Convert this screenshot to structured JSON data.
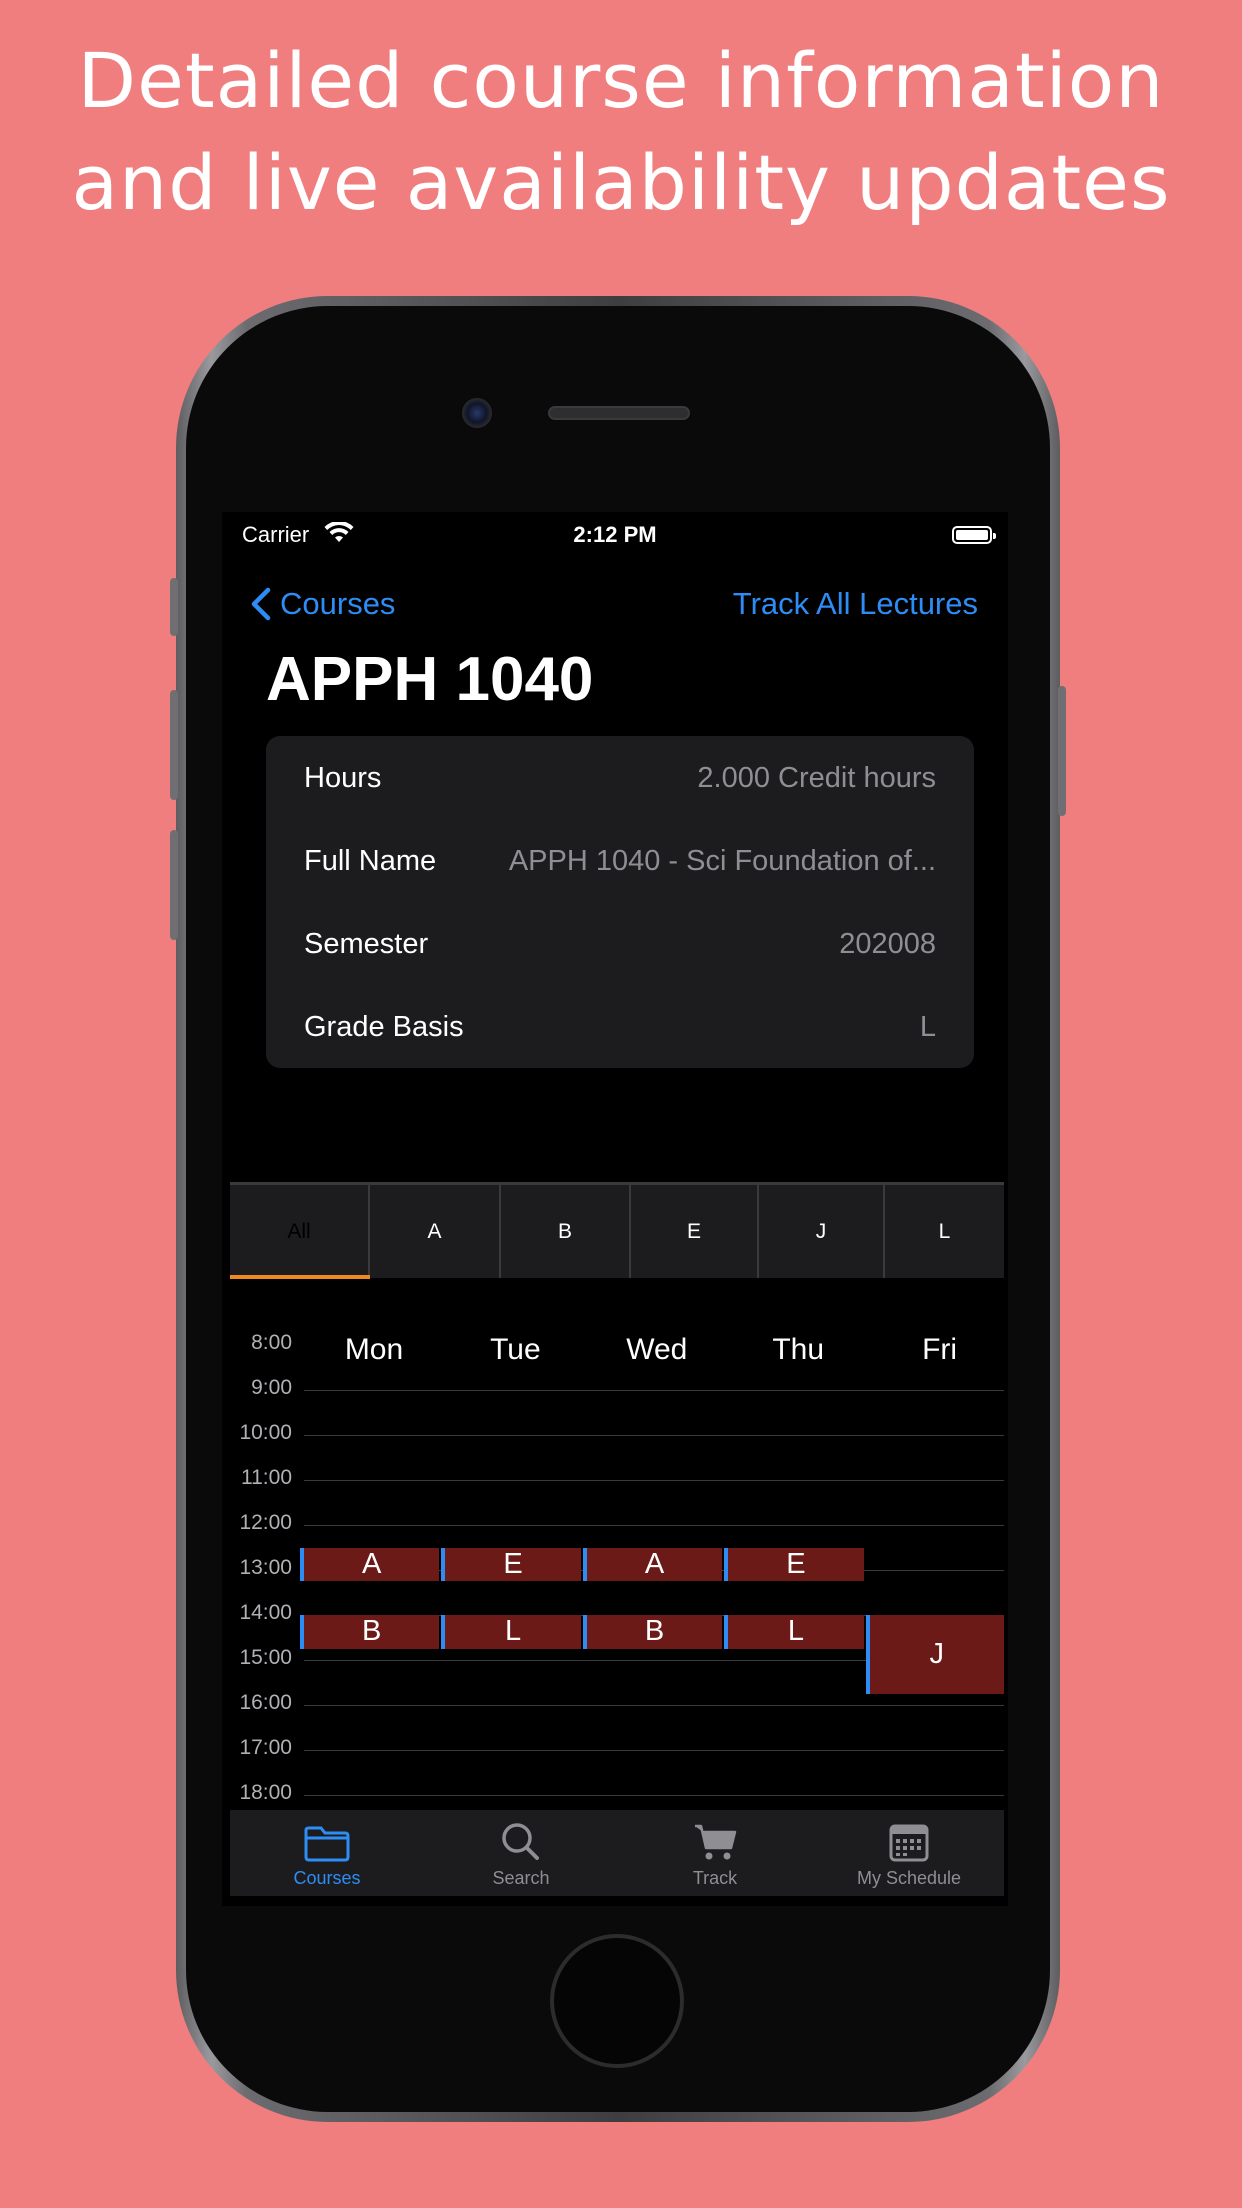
{
  "headline": {
    "line1": "Detailed course information",
    "line2": "and live availability updates"
  },
  "status_bar": {
    "carrier": "Carrier",
    "time": "2:12 PM"
  },
  "nav": {
    "back_label": "Courses",
    "action_label": "Track All Lectures"
  },
  "course": {
    "title": "APPH 1040",
    "info": [
      {
        "key": "Hours",
        "value": "2.000 Credit hours"
      },
      {
        "key": "Full Name",
        "value": "APPH 1040 - Sci Foundation of..."
      },
      {
        "key": "Semester",
        "value": "202008"
      },
      {
        "key": "Grade Basis",
        "value": "L"
      }
    ]
  },
  "section_tabs": {
    "items": [
      "All",
      "A",
      "B",
      "E",
      "J",
      "L"
    ],
    "selected": "All"
  },
  "schedule": {
    "days": [
      "Mon",
      "Tue",
      "Wed",
      "Thu",
      "Fri"
    ],
    "hours": [
      "8:00",
      "9:00",
      "10:00",
      "11:00",
      "12:00",
      "13:00",
      "14:00",
      "15:00",
      "16:00",
      "17:00",
      "18:00"
    ],
    "blocks": [
      {
        "section": "A",
        "day": "Mon",
        "start": "12:30",
        "end": "13:15"
      },
      {
        "section": "E",
        "day": "Tue",
        "start": "12:30",
        "end": "13:15"
      },
      {
        "section": "A",
        "day": "Wed",
        "start": "12:30",
        "end": "13:15"
      },
      {
        "section": "E",
        "day": "Thu",
        "start": "12:30",
        "end": "13:15"
      },
      {
        "section": "B",
        "day": "Mon",
        "start": "14:00",
        "end": "14:45"
      },
      {
        "section": "L",
        "day": "Tue",
        "start": "14:00",
        "end": "14:45"
      },
      {
        "section": "B",
        "day": "Wed",
        "start": "14:00",
        "end": "14:45"
      },
      {
        "section": "L",
        "day": "Thu",
        "start": "14:00",
        "end": "14:45"
      },
      {
        "section": "J",
        "day": "Fri",
        "start": "14:00",
        "end": "15:45"
      }
    ]
  },
  "tab_bar": {
    "items": [
      {
        "label": "Courses",
        "icon": "folder-icon",
        "active": true
      },
      {
        "label": "Search",
        "icon": "search-icon",
        "active": false
      },
      {
        "label": "Track",
        "icon": "cart-icon",
        "active": false
      },
      {
        "label": "My Schedule",
        "icon": "calendar-icon",
        "active": false
      }
    ]
  },
  "colors": {
    "background": "#F07E7E",
    "accent": "#2E8CF5",
    "block_fill": "#6B1A17",
    "tab_underline": "#F08A1E"
  }
}
